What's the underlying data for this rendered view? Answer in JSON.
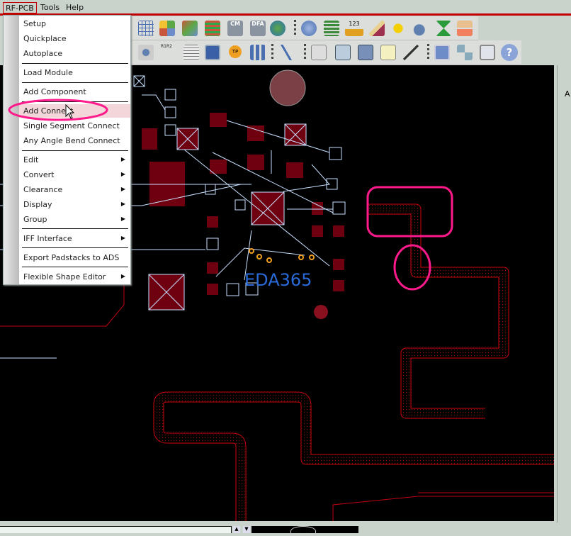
{
  "menubar": {
    "items": [
      "RF-PCB",
      "Tools",
      "Help"
    ]
  },
  "menu": {
    "items": [
      {
        "label": "Setup"
      },
      {
        "label": "Quickplace"
      },
      {
        "label": "Autoplace"
      },
      {
        "label": "Load Module"
      },
      {
        "label": "Add Component"
      },
      {
        "label": "Add Connect"
      },
      {
        "label": "Single Segment Connect"
      },
      {
        "label": "Any Angle Bend Connect"
      },
      {
        "label": "Edit"
      },
      {
        "label": "Convert"
      },
      {
        "label": "Clearance"
      },
      {
        "label": "Display"
      },
      {
        "label": "Group"
      },
      {
        "label": "IFF Interface"
      },
      {
        "label": "Export Padstacks to ADS"
      },
      {
        "label": "Flexible Shape Editor"
      }
    ]
  },
  "toolbar1": {
    "icons": [
      "grid-icon",
      "components-icon",
      "move-component-icon",
      "layers-icon",
      "cm-table-icon",
      "dfa-table-icon",
      "globe-icon",
      "info-icon",
      "table-info-icon",
      "ruler-123-icon",
      "brush-icon",
      "sun-icon",
      "bomb-icon",
      "hourglass-icon",
      "drc-icon"
    ],
    "labels": {
      "cm": "CM",
      "dfa": "DFA",
      "ruler": "123"
    }
  },
  "toolbar2": {
    "icons": [
      "camera-icon",
      "r1r2-icon",
      "probe-icon",
      "matrix-icon",
      "tp-icon",
      "array-icon",
      "path-icon",
      "sim-doc-icon",
      "sim-book-icon",
      "sim-chip-icon",
      "sim-check-icon",
      "sim-probe-icon",
      "windows-icon",
      "bowtie-icon",
      "bowtie-window-icon",
      "help-icon"
    ],
    "labels": {
      "r1r2": "R1R2",
      "tp": "TP"
    }
  },
  "canvas": {
    "watermark": "EDA365"
  },
  "right_panel": {
    "letter": "A"
  },
  "colors": {
    "trace": "#d00010",
    "annotation": "#ff1a8c",
    "accent": "#c00000",
    "ratsnest": "#c8e0ff"
  }
}
